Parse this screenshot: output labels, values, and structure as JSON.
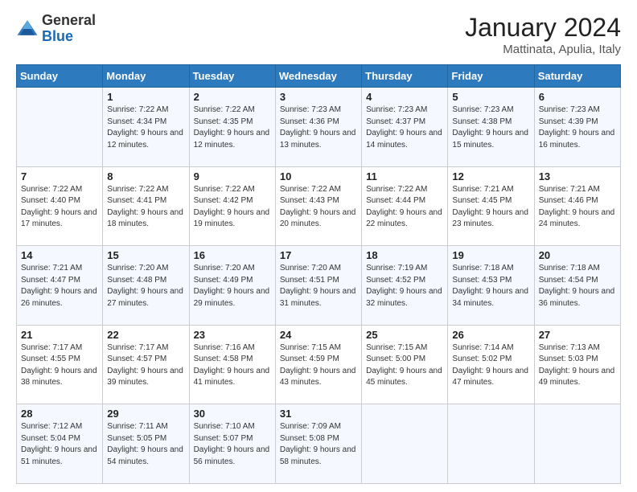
{
  "header": {
    "logo_general": "General",
    "logo_blue": "Blue",
    "month_title": "January 2024",
    "location": "Mattinata, Apulia, Italy"
  },
  "days_of_week": [
    "Sunday",
    "Monday",
    "Tuesday",
    "Wednesday",
    "Thursday",
    "Friday",
    "Saturday"
  ],
  "weeks": [
    [
      {
        "day": "",
        "sunrise": "",
        "sunset": "",
        "daylight": ""
      },
      {
        "day": "1",
        "sunrise": "Sunrise: 7:22 AM",
        "sunset": "Sunset: 4:34 PM",
        "daylight": "Daylight: 9 hours and 12 minutes."
      },
      {
        "day": "2",
        "sunrise": "Sunrise: 7:22 AM",
        "sunset": "Sunset: 4:35 PM",
        "daylight": "Daylight: 9 hours and 12 minutes."
      },
      {
        "day": "3",
        "sunrise": "Sunrise: 7:23 AM",
        "sunset": "Sunset: 4:36 PM",
        "daylight": "Daylight: 9 hours and 13 minutes."
      },
      {
        "day": "4",
        "sunrise": "Sunrise: 7:23 AM",
        "sunset": "Sunset: 4:37 PM",
        "daylight": "Daylight: 9 hours and 14 minutes."
      },
      {
        "day": "5",
        "sunrise": "Sunrise: 7:23 AM",
        "sunset": "Sunset: 4:38 PM",
        "daylight": "Daylight: 9 hours and 15 minutes."
      },
      {
        "day": "6",
        "sunrise": "Sunrise: 7:23 AM",
        "sunset": "Sunset: 4:39 PM",
        "daylight": "Daylight: 9 hours and 16 minutes."
      }
    ],
    [
      {
        "day": "7",
        "sunrise": "Sunrise: 7:22 AM",
        "sunset": "Sunset: 4:40 PM",
        "daylight": "Daylight: 9 hours and 17 minutes."
      },
      {
        "day": "8",
        "sunrise": "Sunrise: 7:22 AM",
        "sunset": "Sunset: 4:41 PM",
        "daylight": "Daylight: 9 hours and 18 minutes."
      },
      {
        "day": "9",
        "sunrise": "Sunrise: 7:22 AM",
        "sunset": "Sunset: 4:42 PM",
        "daylight": "Daylight: 9 hours and 19 minutes."
      },
      {
        "day": "10",
        "sunrise": "Sunrise: 7:22 AM",
        "sunset": "Sunset: 4:43 PM",
        "daylight": "Daylight: 9 hours and 20 minutes."
      },
      {
        "day": "11",
        "sunrise": "Sunrise: 7:22 AM",
        "sunset": "Sunset: 4:44 PM",
        "daylight": "Daylight: 9 hours and 22 minutes."
      },
      {
        "day": "12",
        "sunrise": "Sunrise: 7:21 AM",
        "sunset": "Sunset: 4:45 PM",
        "daylight": "Daylight: 9 hours and 23 minutes."
      },
      {
        "day": "13",
        "sunrise": "Sunrise: 7:21 AM",
        "sunset": "Sunset: 4:46 PM",
        "daylight": "Daylight: 9 hours and 24 minutes."
      }
    ],
    [
      {
        "day": "14",
        "sunrise": "Sunrise: 7:21 AM",
        "sunset": "Sunset: 4:47 PM",
        "daylight": "Daylight: 9 hours and 26 minutes."
      },
      {
        "day": "15",
        "sunrise": "Sunrise: 7:20 AM",
        "sunset": "Sunset: 4:48 PM",
        "daylight": "Daylight: 9 hours and 27 minutes."
      },
      {
        "day": "16",
        "sunrise": "Sunrise: 7:20 AM",
        "sunset": "Sunset: 4:49 PM",
        "daylight": "Daylight: 9 hours and 29 minutes."
      },
      {
        "day": "17",
        "sunrise": "Sunrise: 7:20 AM",
        "sunset": "Sunset: 4:51 PM",
        "daylight": "Daylight: 9 hours and 31 minutes."
      },
      {
        "day": "18",
        "sunrise": "Sunrise: 7:19 AM",
        "sunset": "Sunset: 4:52 PM",
        "daylight": "Daylight: 9 hours and 32 minutes."
      },
      {
        "day": "19",
        "sunrise": "Sunrise: 7:18 AM",
        "sunset": "Sunset: 4:53 PM",
        "daylight": "Daylight: 9 hours and 34 minutes."
      },
      {
        "day": "20",
        "sunrise": "Sunrise: 7:18 AM",
        "sunset": "Sunset: 4:54 PM",
        "daylight": "Daylight: 9 hours and 36 minutes."
      }
    ],
    [
      {
        "day": "21",
        "sunrise": "Sunrise: 7:17 AM",
        "sunset": "Sunset: 4:55 PM",
        "daylight": "Daylight: 9 hours and 38 minutes."
      },
      {
        "day": "22",
        "sunrise": "Sunrise: 7:17 AM",
        "sunset": "Sunset: 4:57 PM",
        "daylight": "Daylight: 9 hours and 39 minutes."
      },
      {
        "day": "23",
        "sunrise": "Sunrise: 7:16 AM",
        "sunset": "Sunset: 4:58 PM",
        "daylight": "Daylight: 9 hours and 41 minutes."
      },
      {
        "day": "24",
        "sunrise": "Sunrise: 7:15 AM",
        "sunset": "Sunset: 4:59 PM",
        "daylight": "Daylight: 9 hours and 43 minutes."
      },
      {
        "day": "25",
        "sunrise": "Sunrise: 7:15 AM",
        "sunset": "Sunset: 5:00 PM",
        "daylight": "Daylight: 9 hours and 45 minutes."
      },
      {
        "day": "26",
        "sunrise": "Sunrise: 7:14 AM",
        "sunset": "Sunset: 5:02 PM",
        "daylight": "Daylight: 9 hours and 47 minutes."
      },
      {
        "day": "27",
        "sunrise": "Sunrise: 7:13 AM",
        "sunset": "Sunset: 5:03 PM",
        "daylight": "Daylight: 9 hours and 49 minutes."
      }
    ],
    [
      {
        "day": "28",
        "sunrise": "Sunrise: 7:12 AM",
        "sunset": "Sunset: 5:04 PM",
        "daylight": "Daylight: 9 hours and 51 minutes."
      },
      {
        "day": "29",
        "sunrise": "Sunrise: 7:11 AM",
        "sunset": "Sunset: 5:05 PM",
        "daylight": "Daylight: 9 hours and 54 minutes."
      },
      {
        "day": "30",
        "sunrise": "Sunrise: 7:10 AM",
        "sunset": "Sunset: 5:07 PM",
        "daylight": "Daylight: 9 hours and 56 minutes."
      },
      {
        "day": "31",
        "sunrise": "Sunrise: 7:09 AM",
        "sunset": "Sunset: 5:08 PM",
        "daylight": "Daylight: 9 hours and 58 minutes."
      },
      {
        "day": "",
        "sunrise": "",
        "sunset": "",
        "daylight": ""
      },
      {
        "day": "",
        "sunrise": "",
        "sunset": "",
        "daylight": ""
      },
      {
        "day": "",
        "sunrise": "",
        "sunset": "",
        "daylight": ""
      }
    ]
  ]
}
